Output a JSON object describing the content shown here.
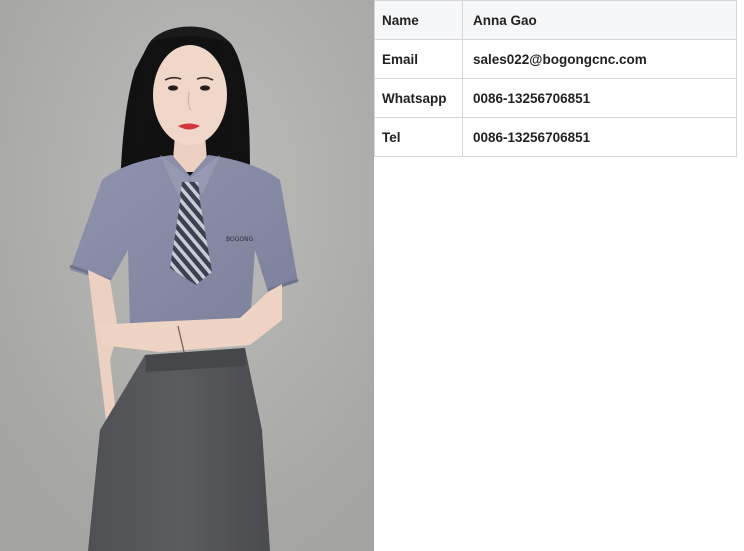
{
  "profile_table": {
    "rows": [
      {
        "label": "Name",
        "value": "Anna Gao"
      },
      {
        "label": "Email",
        "value": "sales022@bogongcnc.com"
      },
      {
        "label": "Whatsapp",
        "value": "0086-13256706851"
      },
      {
        "label": "Tel",
        "value": "0086-13256706851"
      }
    ]
  },
  "photo": {
    "shirt_logo_text": "BOGONG"
  }
}
